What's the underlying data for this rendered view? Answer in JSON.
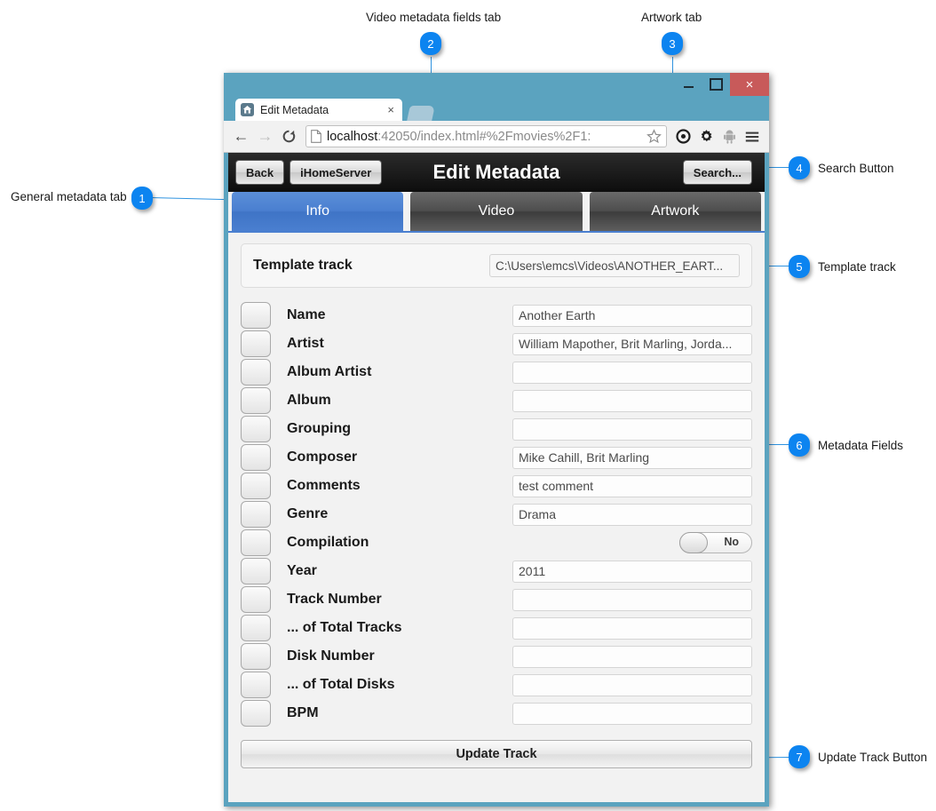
{
  "window": {
    "controls": {
      "minimize": "minimize-button",
      "maximize": "maximize-button",
      "close": "×"
    }
  },
  "browser": {
    "tab_title": "Edit Metadata",
    "tab_close": "×",
    "back": "←",
    "forward": "→",
    "reload": "C",
    "url_host": "localhost",
    "url_rest": ":42050/index.html#%2Fmovies%2F1:",
    "url_full": "localhost:42050/index.html#%2Fmovies%2F1:"
  },
  "app": {
    "title": "Edit Metadata",
    "back_label": "Back",
    "brand_label": "iHomeServer",
    "search_label": "Search...",
    "tabs": [
      {
        "label": "Info",
        "active": true
      },
      {
        "label": "Video",
        "active": false
      },
      {
        "label": "Artwork",
        "active": false
      }
    ],
    "template": {
      "label": "Template track",
      "value": "C:\\Users\\emcs\\Videos\\ANOTHER_EART..."
    },
    "fields": [
      {
        "label": "Name",
        "value": "Another Earth",
        "type": "text"
      },
      {
        "label": "Artist",
        "value": "William Mapother, Brit Marling, Jorda...",
        "type": "text"
      },
      {
        "label": "Album Artist",
        "value": "",
        "type": "text"
      },
      {
        "label": "Album",
        "value": "",
        "type": "text"
      },
      {
        "label": "Grouping",
        "value": "",
        "type": "text"
      },
      {
        "label": "Composer",
        "value": "Mike Cahill, Brit Marling",
        "type": "text"
      },
      {
        "label": "Comments",
        "value": "test comment",
        "type": "text"
      },
      {
        "label": "Genre",
        "value": "Drama",
        "type": "text"
      },
      {
        "label": "Compilation",
        "value": "No",
        "type": "toggle"
      },
      {
        "label": "Year",
        "value": "2011",
        "type": "text"
      },
      {
        "label": "Track Number",
        "value": "",
        "type": "text"
      },
      {
        "label": "... of Total Tracks",
        "value": "",
        "type": "text"
      },
      {
        "label": "Disk Number",
        "value": "",
        "type": "text"
      },
      {
        "label": "... of Total Disks",
        "value": "",
        "type": "text"
      },
      {
        "label": "BPM",
        "value": "",
        "type": "text"
      }
    ],
    "update_label": "Update Track"
  },
  "annotations": {
    "accent_color": "#0c84f0",
    "leader_color": "#2f93e0",
    "items": [
      {
        "number": "1",
        "label": "General metadata tab"
      },
      {
        "number": "2",
        "label": "Video metadata fields tab"
      },
      {
        "number": "3",
        "label": "Artwork tab"
      },
      {
        "number": "4",
        "label": "Search Button"
      },
      {
        "number": "5",
        "label": "Template track"
      },
      {
        "number": "6",
        "label": "Metadata Fields"
      },
      {
        "number": "7",
        "label": "Update Track Button"
      }
    ]
  }
}
